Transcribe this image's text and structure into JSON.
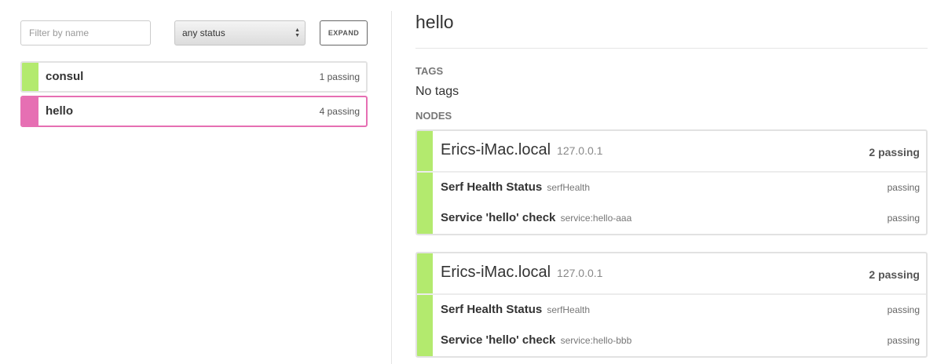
{
  "colors": {
    "passing": "#b3ea6e",
    "selected": "#e66fb3"
  },
  "filter": {
    "placeholder": "Filter by name"
  },
  "status_select": {
    "value": "any status",
    "icon": "updown-arrows-icon"
  },
  "expand_label": "EXPAND",
  "services": [
    {
      "name": "consul",
      "count": "1 passing",
      "active": false
    },
    {
      "name": "hello",
      "count": "4 passing",
      "active": true
    }
  ],
  "detail": {
    "title": "hello",
    "tags_label": "TAGS",
    "tags_value": "No tags",
    "nodes_label": "NODES",
    "nodes": [
      {
        "name": "Erics-iMac.local",
        "address": "127.0.0.1",
        "count": "2 passing",
        "checks": [
          {
            "name": "Serf Health Status",
            "id": "serfHealth",
            "status": "passing"
          },
          {
            "name": "Service 'hello' check",
            "id": "service:hello-aaa",
            "status": "passing"
          }
        ]
      },
      {
        "name": "Erics-iMac.local",
        "address": "127.0.0.1",
        "count": "2 passing",
        "checks": [
          {
            "name": "Serf Health Status",
            "id": "serfHealth",
            "status": "passing"
          },
          {
            "name": "Service 'hello' check",
            "id": "service:hello-bbb",
            "status": "passing"
          }
        ]
      }
    ]
  }
}
